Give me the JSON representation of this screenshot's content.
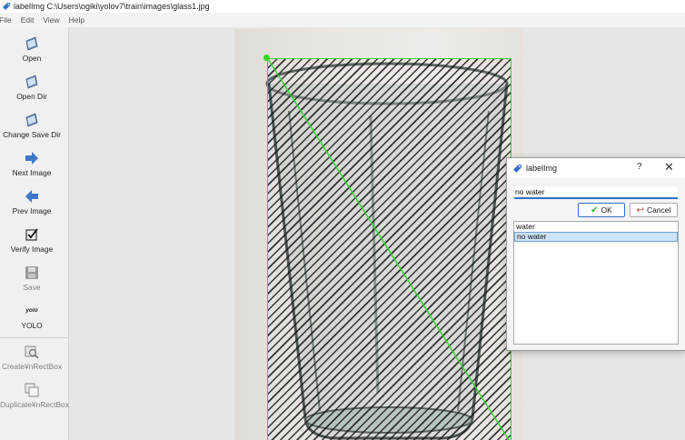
{
  "window": {
    "title": "labelImg C:\\Users\\ogiki\\yolov7\\train\\images\\glass1.jpg"
  },
  "menu": [
    "File",
    "Edit",
    "View",
    "Help"
  ],
  "toolbar": {
    "open": "Open",
    "open_dir": "Open Dir",
    "change_save_dir": "Change Save Dir",
    "next_image": "Next Image",
    "prev_image": "Prev Image",
    "verify_image": "Verify Image",
    "save": "Save",
    "yolo_badge": "yolo",
    "yolo": "YOLO",
    "create_rectbox": "Create¥nRectBox",
    "duplicate_rectbox": "Duplicate¥nRectBox"
  },
  "dialog": {
    "title": "labelImg",
    "help": "?",
    "close": "✕",
    "input_value": "no water",
    "ok_label": "OK",
    "cancel_label": "Cancel",
    "ok_icon": "✔",
    "cancel_icon": "↩",
    "labels": [
      "water",
      "no water"
    ],
    "selected_label": "no water"
  },
  "colors": {
    "bbox": "#35d035",
    "accent": "#2f6fc7",
    "selection": "#cde3f7"
  }
}
